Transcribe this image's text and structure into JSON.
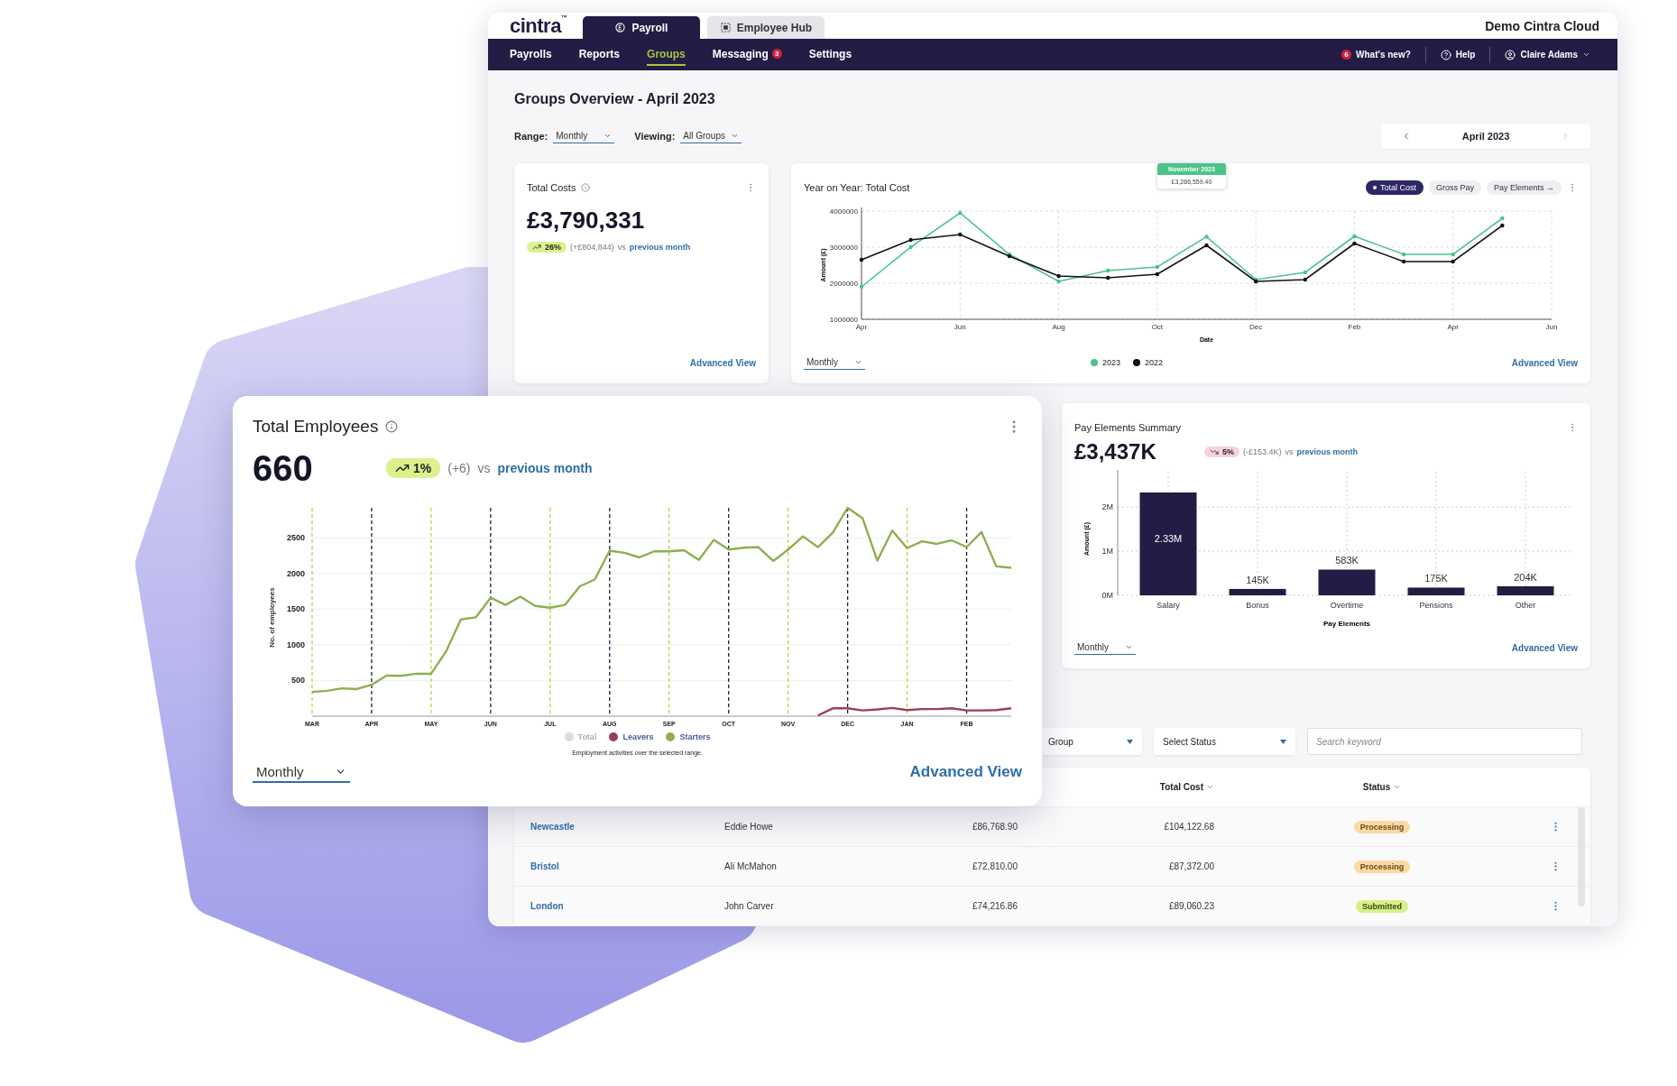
{
  "brand": {
    "logo": "cintra",
    "mark": "™"
  },
  "app_tabs": [
    {
      "label": "Payroll",
      "selected": true
    },
    {
      "label": "Employee Hub",
      "selected": false
    }
  ],
  "account": "Demo Cintra Cloud",
  "nav": {
    "items": [
      {
        "label": "Payrolls",
        "selected": false
      },
      {
        "label": "Reports",
        "selected": false
      },
      {
        "label": "Groups",
        "selected": true
      },
      {
        "label": "Messaging",
        "selected": false,
        "badge": "3"
      },
      {
        "label": "Settings",
        "selected": false
      }
    ],
    "whats_new": {
      "badge": "6",
      "label": "What's new?"
    },
    "help": "Help",
    "user": "Claire Adams"
  },
  "page": {
    "title": "Groups Overview - April 2023",
    "filters": [
      {
        "label": "Range:",
        "value": "Monthly"
      },
      {
        "label": "Viewing:",
        "value": "All Groups"
      }
    ],
    "period": {
      "label": "April 2023",
      "next_disabled": true
    }
  },
  "total_costs": {
    "title": "Total Costs",
    "value": "£3,790,331",
    "change": {
      "rising": true,
      "percent": "26%",
      "delta": "(+£804,844)",
      "vs": "vs",
      "link": "previous month"
    },
    "footer_link": "Advanced View"
  },
  "year_on_year": {
    "title": "Year on Year: Total Cost",
    "toggles": [
      {
        "label": "Total Cost",
        "selected": true
      },
      {
        "label": "Gross Pay",
        "selected": false
      },
      {
        "label": "Pay Elements →",
        "selected": false
      }
    ],
    "chart_data": {
      "type": "line",
      "xlabel": "Date",
      "ylabel": "Amount (£)",
      "categories": [
        "Apr",
        null,
        "Jun",
        null,
        "Aug",
        null,
        "Oct",
        null,
        "Dec",
        null,
        "Feb",
        null,
        "Apr",
        null,
        "Jun"
      ],
      "ylim": [
        1000000,
        4000000
      ],
      "yticks": [
        1000000,
        2000000,
        3000000,
        4000000
      ],
      "series": [
        {
          "name": "2023",
          "color": "#4cc38a",
          "values": [
            1900000,
            3000000,
            3950000,
            2800000,
            2050000,
            2350000,
            2450000,
            3290000,
            2100000,
            2300000,
            3300000,
            2800000,
            2800000,
            3800000,
            null
          ]
        },
        {
          "name": "2022",
          "color": "#111111",
          "values": [
            2650000,
            3200000,
            3350000,
            2750000,
            2200000,
            2150000,
            2250000,
            3050000,
            2050000,
            2100000,
            3100000,
            2600000,
            2600000,
            3600000,
            null
          ]
        }
      ],
      "grid": true
    },
    "tooltip": {
      "title": "November 2023",
      "value": "£3,286,559.40"
    },
    "range": "Monthly",
    "footer_link": "Advanced View"
  },
  "total_employees": {
    "title": "Total Employees",
    "value": "660",
    "change": {
      "rising": true,
      "percent": "1%",
      "delta": "(+6)",
      "vs": "vs",
      "link": "previous month"
    },
    "chart_data": {
      "type": "line",
      "ylabel": "No. of employees",
      "categories": [
        "MAR",
        null,
        null,
        null,
        "APR",
        null,
        null,
        null,
        "MAY",
        null,
        null,
        null,
        "JUN",
        null,
        null,
        null,
        "JUL",
        null,
        null,
        null,
        "AUG",
        null,
        null,
        null,
        "SEP",
        null,
        null,
        null,
        "OCT",
        null,
        null,
        null,
        "NOV",
        null,
        null,
        null,
        "DEC",
        null,
        null,
        null,
        "JAN",
        null,
        null,
        null,
        "FEB",
        null,
        null,
        null
      ],
      "ylim": [
        0,
        2920
      ],
      "grid": true,
      "yticks": [
        500,
        1000,
        1500,
        2000,
        2500
      ],
      "series": [
        {
          "name": "Leavers",
          "color": "#9b3d5c",
          "values": [
            null,
            null,
            null,
            null,
            null,
            null,
            null,
            null,
            null,
            null,
            null,
            null,
            null,
            null,
            null,
            null,
            null,
            null,
            null,
            null,
            null,
            null,
            null,
            null,
            null,
            null,
            null,
            null,
            null,
            null,
            null,
            null,
            null,
            null,
            10,
            110,
            110,
            80,
            95,
            115,
            85,
            100,
            100,
            110,
            80,
            80,
            85,
            110
          ]
        },
        {
          "name": "Starters",
          "color": "#8fae4f",
          "values": [
            340,
            355,
            390,
            380,
            440,
            570,
            565,
            595,
            595,
            905,
            1355,
            1385,
            1660,
            1560,
            1675,
            1545,
            1520,
            1560,
            1820,
            1915,
            2320,
            2290,
            2225,
            2310,
            2310,
            2325,
            2190,
            2470,
            2335,
            2360,
            2370,
            2175,
            2335,
            2520,
            2370,
            2570,
            2920,
            2775,
            2180,
            2600,
            2355,
            2450,
            2415,
            2465,
            2370,
            2580,
            2100,
            2080
          ]
        }
      ]
    },
    "legend_extra": [
      {
        "label": "Total",
        "color": "#d7dbe3",
        "disabled": true
      }
    ],
    "caption": "Employment activities over the selected range.",
    "range": "Monthly",
    "footer_link": "Advanced View"
  },
  "pay_elements": {
    "title": "Pay Elements Summary",
    "value": "£3,437K",
    "change": {
      "rising": false,
      "percent": "5%",
      "delta": "(-£153.4K)",
      "vs": "vs",
      "link": "previous month"
    },
    "chart_data": {
      "type": "bar",
      "xlabel": "Pay Elements",
      "ylabel": "Amount (£)",
      "categories": [
        "Salary",
        "Bonus",
        "Overtime",
        "Pensions",
        "Other"
      ],
      "values": [
        2330000,
        145000,
        583000,
        175000,
        204000
      ],
      "value_labels": [
        "2.33M",
        "145K",
        "583K",
        "175K",
        "204K"
      ],
      "ylim": [
        0,
        2800000
      ],
      "grid": true,
      "yticks": [
        {
          "value": 0,
          "label": "0M"
        },
        {
          "value": 1000000,
          "label": "1M"
        },
        {
          "value": 2000000,
          "label": "2M"
        }
      ]
    },
    "range": "Monthly",
    "footer_link": "Advanced View"
  },
  "groups_table": {
    "filters": [
      {
        "kind": "select",
        "value": "Group"
      },
      {
        "kind": "select",
        "value": "Select Status"
      },
      {
        "kind": "search",
        "placeholder": "Search keyword"
      }
    ],
    "columns": [
      {
        "label": "Total Cost",
        "sortable": true
      },
      {
        "label": "Status",
        "sortable": true
      }
    ],
    "rows": [
      {
        "group": "Newcastle",
        "manager": "Eddie Howe",
        "column_3": "£86,768.90",
        "total_cost": "£104,122.68",
        "status": {
          "label": "Processing",
          "kind": "processing"
        }
      },
      {
        "group": "Bristol",
        "manager": "Ali McMahon",
        "column_3": "£72,810.00",
        "total_cost": "£87,372.00",
        "status": {
          "label": "Processing",
          "kind": "processing"
        }
      },
      {
        "group": "London",
        "manager": "John Carver",
        "column_3": "£74,216.86",
        "total_cost": "£89,060.23",
        "status": {
          "label": "Submitted",
          "kind": "submitted"
        }
      }
    ]
  }
}
